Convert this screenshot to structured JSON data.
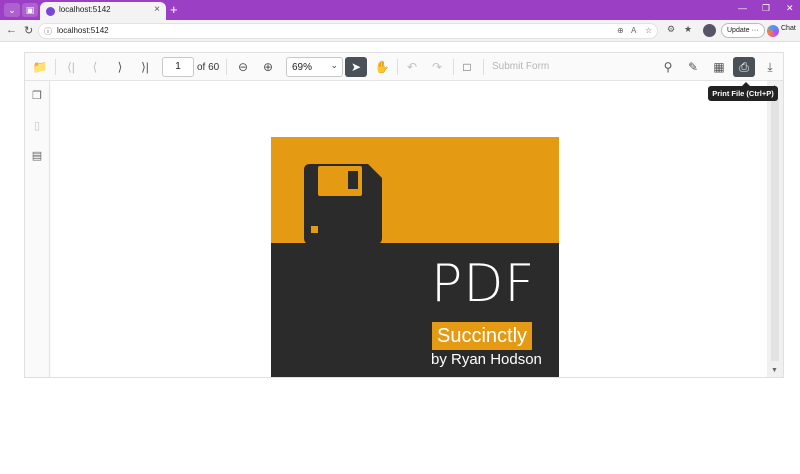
{
  "browser": {
    "tab_title": "localhost:5142",
    "url": "localhost:5142",
    "update_label": "Update",
    "chat_label": "Chat"
  },
  "toolbar": {
    "page_number": "1",
    "page_count": "of 60",
    "zoom": "69%",
    "submit_label": "Submit Form"
  },
  "tooltip": "Print File (Ctrl+P)",
  "cover": {
    "title": "PDF",
    "series": "Succinctly",
    "author": "by Ryan Hodson",
    "colors": {
      "accent": "#e59a13",
      "dark": "#2b2b2b"
    }
  },
  "icons": {
    "open": "folder-icon",
    "first": "first-page-icon",
    "prev": "previous-page-icon",
    "next": "next-page-icon",
    "last": "last-page-icon",
    "zoom_out": "zoom-out-icon",
    "zoom_in": "zoom-in-icon",
    "select": "cursor-icon",
    "pan": "hand-icon",
    "undo": "undo-icon",
    "redo": "redo-icon",
    "comment": "comment-icon",
    "search": "search-icon",
    "annotate": "annotation-icon",
    "organize": "organize-pages-icon",
    "print": "print-icon",
    "download": "download-icon"
  },
  "accent_colors": {
    "browser_frame": "#9b3fc4",
    "active_tool": "#495057"
  }
}
